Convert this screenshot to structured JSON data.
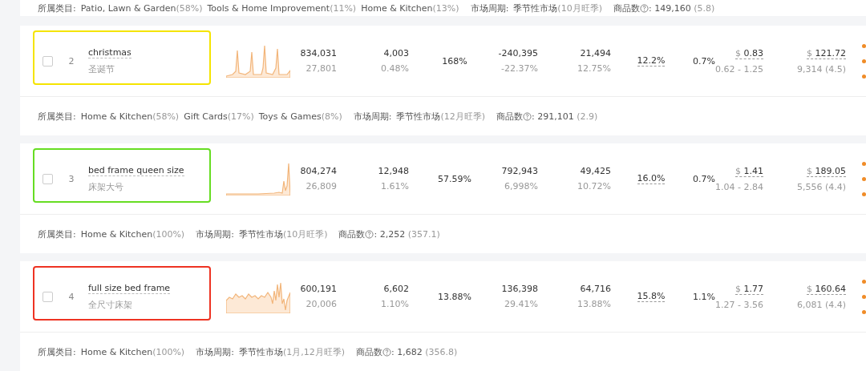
{
  "previous_footer": {
    "category_label": "所属类目:",
    "categories": [
      {
        "name": "Patio, Lawn & Garden",
        "share": "(58%)"
      },
      {
        "name": "Tools & Home Improvement",
        "share": "(11%)"
      },
      {
        "name": "Home & Kitchen",
        "share": "(13%)"
      }
    ],
    "cycle_label": "市场周期:",
    "cycle": "季节性市场",
    "cycle_note": "(10月旺季)",
    "count_label": "商品数",
    "count": ": 149,160",
    "count_note": "(5.8)"
  },
  "rows": [
    {
      "index": "2",
      "keyword": "christmas",
      "translation": "圣诞节",
      "checked": false,
      "color": "#f5e400",
      "column_1": [
        "834,031",
        "27,801"
      ],
      "column_2": [
        "4,003",
        "0.48%"
      ],
      "column_3": "168%",
      "column_4": [
        "-240,395",
        "-22.37%"
      ],
      "column_5": [
        "21,494",
        "12.75%"
      ],
      "column_6": "12.2%",
      "column_7": "0.7%",
      "column_8": {
        "currency": "$",
        "value": "0.83",
        "sub": "0.62 - 1.25"
      },
      "column_9": {
        "currency": "$",
        "value": "121.72",
        "sub": "9,314 (4.5)"
      },
      "footer": {
        "category_label": "所属类目:",
        "categories": [
          {
            "name": "Home & Kitchen",
            "share": "(58%)"
          },
          {
            "name": "Gift Cards",
            "share": "(17%)"
          },
          {
            "name": "Toys & Games",
            "share": "(8%)"
          }
        ],
        "cycle_label": "市场周期:",
        "cycle": "季节性市场",
        "cycle_note": "(12月旺季)",
        "count_label": "商品数",
        "count": ": 291,101",
        "count_note": "(2.9)"
      }
    },
    {
      "index": "3",
      "keyword": "bed frame queen size",
      "translation": "床架大号",
      "checked": false,
      "color": "#66dd22",
      "column_1": [
        "804,274",
        "26,809"
      ],
      "column_2": [
        "12,948",
        "1.61%"
      ],
      "column_3": "57.59%",
      "column_4": [
        "792,943",
        "6,998%"
      ],
      "column_5": [
        "49,425",
        "10.72%"
      ],
      "column_6": "16.0%",
      "column_7": "0.7%",
      "column_8": {
        "currency": "$",
        "value": "1.41",
        "sub": "1.04 - 2.84"
      },
      "column_9": {
        "currency": "$",
        "value": "189.05",
        "sub": "5,556 (4.4)"
      },
      "footer": {
        "category_label": "所属类目:",
        "categories": [
          {
            "name": "Home & Kitchen",
            "share": "(100%)"
          }
        ],
        "cycle_label": "市场周期:",
        "cycle": "季节性市场",
        "cycle_note": "(10月旺季)",
        "count_label": "商品数",
        "count": ": 2,252",
        "count_note": "(357.1)"
      }
    },
    {
      "index": "4",
      "keyword": "full size bed frame",
      "translation": "全尺寸床架",
      "checked": false,
      "color": "#ee3322",
      "column_1": [
        "600,191",
        "20,006"
      ],
      "column_2": [
        "6,602",
        "1.10%"
      ],
      "column_3": "13.88%",
      "column_4": [
        "136,398",
        "29.41%"
      ],
      "column_5": [
        "64,716",
        "13.88%"
      ],
      "column_6": "15.8%",
      "column_7": "1.1%",
      "column_8": {
        "currency": "$",
        "value": "1.77",
        "sub": "1.27 - 3.56"
      },
      "column_9": {
        "currency": "$",
        "value": "160.64",
        "sub": "6,081 (4.4)"
      },
      "footer": {
        "category_label": "所属类目:",
        "categories": [
          {
            "name": "Home & Kitchen",
            "share": "(100%)"
          }
        ],
        "cycle_label": "市场周期:",
        "cycle": "季节性市场",
        "cycle_note": "(1月,12月旺季)",
        "count_label": "商品数",
        "count": ": 1,682",
        "count_note": "(356.8)"
      }
    }
  ]
}
